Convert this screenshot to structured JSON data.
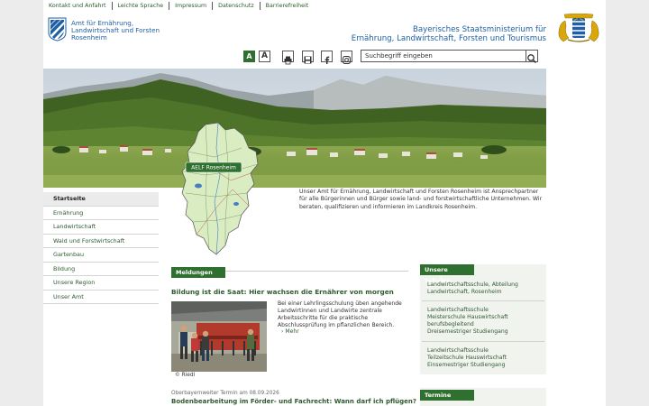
{
  "topnav": [
    "Kontakt und Anfahrt",
    "Leichte Sprache",
    "Impressum",
    "Datenschutz",
    "Barrierefreiheit"
  ],
  "amt": {
    "name_lines": [
      "Amt für Ernährung,",
      "Landwirtschaft und Forsten",
      "Rosenheim"
    ]
  },
  "ministry": {
    "name_lines": [
      "Bayerisches Staatsministerium für",
      "Ernährung, Landwirtschaft, Forsten und Tourismus"
    ]
  },
  "toolbar": {
    "font_small": "A",
    "font_large": "A",
    "icons": [
      "print-icon",
      "save-icon",
      "facebook-icon",
      "instagram-icon",
      "search-icon"
    ]
  },
  "search": {
    "value": "Suchbegriff eingeben"
  },
  "map": {
    "label": "AELF Rosenheim"
  },
  "intro": "Unser Amt für Ernährung, Landwirtschaft und Forsten Rosenheim ist Ansprechpartner für alle Bürgerinnen und Bürger sowie land- und forstwirtschaftliche Unternehmen. Wir beraten, qualifizieren und informieren im Landkreis Rosenheim.",
  "sidenav": [
    "Startseite",
    "Ernährung",
    "Landwirtschaft",
    "Wald und Forstwirtschaft",
    "Gartenbau",
    "Bildung",
    "Unsere Region",
    "Unser Amt"
  ],
  "news": {
    "section_label": "Meldungen",
    "headline": "Bildung ist die Saat: Hier wachsen die Ernährer von morgen",
    "body": "Bei einer Lehrlingsschulung üben angehende Landwirtinnen und Landwirte zentrale Arbeitsschritte für die praktische Abschlussprüfung im pflanzlichen Bereich.",
    "more": "Mehr",
    "caption": "© Riedl",
    "meta2": "Oberbayernweiter Termin am 08.09.2026",
    "headline2": "Bodenbearbeitung im Förder- und Fachrecht: Wann darf ich pflügen?"
  },
  "schools": {
    "section_label": "Unsere Schulen",
    "items": [
      [
        "Landwirtschaftsschule, Abteilung",
        "Landwirtschaft, Rosenheim"
      ],
      [
        "Landwirtschaftsschule",
        "Meisterschule Hauswirtschaft",
        "berufsbegleitend",
        "Dreisemestriger Studiengang"
      ],
      [
        "Landwirtschaftsschule",
        "Teilzeitschule Hauswirtschaft",
        "Einsemestriger Studiengang"
      ]
    ]
  },
  "termine": {
    "section_label": "Termine"
  },
  "colors": {
    "accent_green": "#2f6f2f",
    "link_green": "#2e5a2e",
    "ministry_blue": "#1f5fa6"
  }
}
